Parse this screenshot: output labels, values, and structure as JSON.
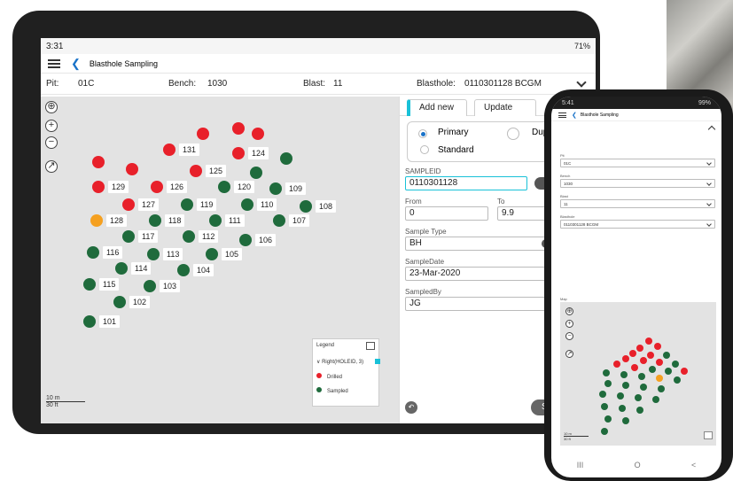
{
  "tablet": {
    "status": {
      "time": "3:31",
      "battery": "71%"
    },
    "appbar": {
      "title": "Blasthole Sampling"
    },
    "filters": {
      "pit_label": "Pit:",
      "pit_value": "01C",
      "bench_label": "Bench:",
      "bench_value": "1030",
      "blast_label": "Blast:",
      "blast_value": "11",
      "blasthole_label": "Blasthole:",
      "blasthole_value": "0110301128 BCGM"
    },
    "map": {
      "holes": [
        {
          "id": "",
          "color": "red"
        },
        {
          "id": "",
          "color": "red"
        },
        {
          "id": "",
          "color": "red"
        },
        {
          "id": "131",
          "color": "red"
        },
        {
          "id": "124",
          "color": "red"
        },
        {
          "id": "",
          "color": "green"
        },
        {
          "id": "",
          "color": "red"
        },
        {
          "id": "",
          "color": "red"
        },
        {
          "id": "125",
          "color": "red"
        },
        {
          "id": "",
          "color": "green"
        },
        {
          "id": "129",
          "color": "red"
        },
        {
          "id": "126",
          "color": "red"
        },
        {
          "id": "120",
          "color": "green"
        },
        {
          "id": "109",
          "color": "green"
        },
        {
          "id": "127",
          "color": "red"
        },
        {
          "id": "119",
          "color": "green"
        },
        {
          "id": "110",
          "color": "green"
        },
        {
          "id": "108",
          "color": "green"
        },
        {
          "id": "128",
          "color": "orange"
        },
        {
          "id": "118",
          "color": "green"
        },
        {
          "id": "111",
          "color": "green"
        },
        {
          "id": "107",
          "color": "green"
        },
        {
          "id": "117",
          "color": "green"
        },
        {
          "id": "112",
          "color": "green"
        },
        {
          "id": "106",
          "color": "green"
        },
        {
          "id": "116",
          "color": "green"
        },
        {
          "id": "113",
          "color": "green"
        },
        {
          "id": "105",
          "color": "green"
        },
        {
          "id": "114",
          "color": "green"
        },
        {
          "id": "104",
          "color": "green"
        },
        {
          "id": "115",
          "color": "green"
        },
        {
          "id": "103",
          "color": "green"
        },
        {
          "id": "102",
          "color": "green"
        },
        {
          "id": "101",
          "color": "green"
        }
      ],
      "legend": {
        "title": "Legend",
        "layer": "Right(HOLEID, 3)",
        "items": [
          {
            "label": "Drilled",
            "color": "#e8202a"
          },
          {
            "label": "Sampled",
            "color": "#1f6b3c"
          }
        ]
      },
      "scale": {
        "metric": "10 m",
        "imperial": "30 ft"
      }
    },
    "panel": {
      "tabs": [
        "Add new",
        "Update"
      ],
      "radios": {
        "primary": "Primary",
        "duplicate": "Duplicate",
        "standard": "Standard"
      },
      "sampleid": {
        "label": "SAMPLEID",
        "value": "0110301128",
        "scan": "scan"
      },
      "from": {
        "label": "From",
        "value": "0"
      },
      "to": {
        "label": "To",
        "value": "9.9"
      },
      "sample_type": {
        "label": "Sample Type",
        "value": "BH"
      },
      "sample_date": {
        "label": "SampleDate",
        "value": "23-Mar-2020"
      },
      "sampled_by": {
        "label": "SampledBy",
        "value": "JG"
      },
      "save_label": "Sa"
    }
  },
  "phone": {
    "status": {
      "time": "5:41",
      "battery": "99%"
    },
    "appbar": {
      "title": "Blasthole Sampling"
    },
    "fields": [
      {
        "label": "Pit",
        "value": "01C"
      },
      {
        "label": "Bench",
        "value": "1030"
      },
      {
        "label": "Blast",
        "value": "11"
      },
      {
        "label": "Blasthole",
        "value": "0110301128 BCGM"
      }
    ],
    "map_label": "Map",
    "scale": {
      "metric": "10 m",
      "imperial": "30 ft"
    },
    "nav": {
      "recents": "III",
      "home": "O",
      "back": "<"
    }
  },
  "colors": {
    "drilled": "#e8202a",
    "sampled": "#1f6b3c",
    "selected": "#f5a020",
    "accent": "#19c1d8"
  }
}
